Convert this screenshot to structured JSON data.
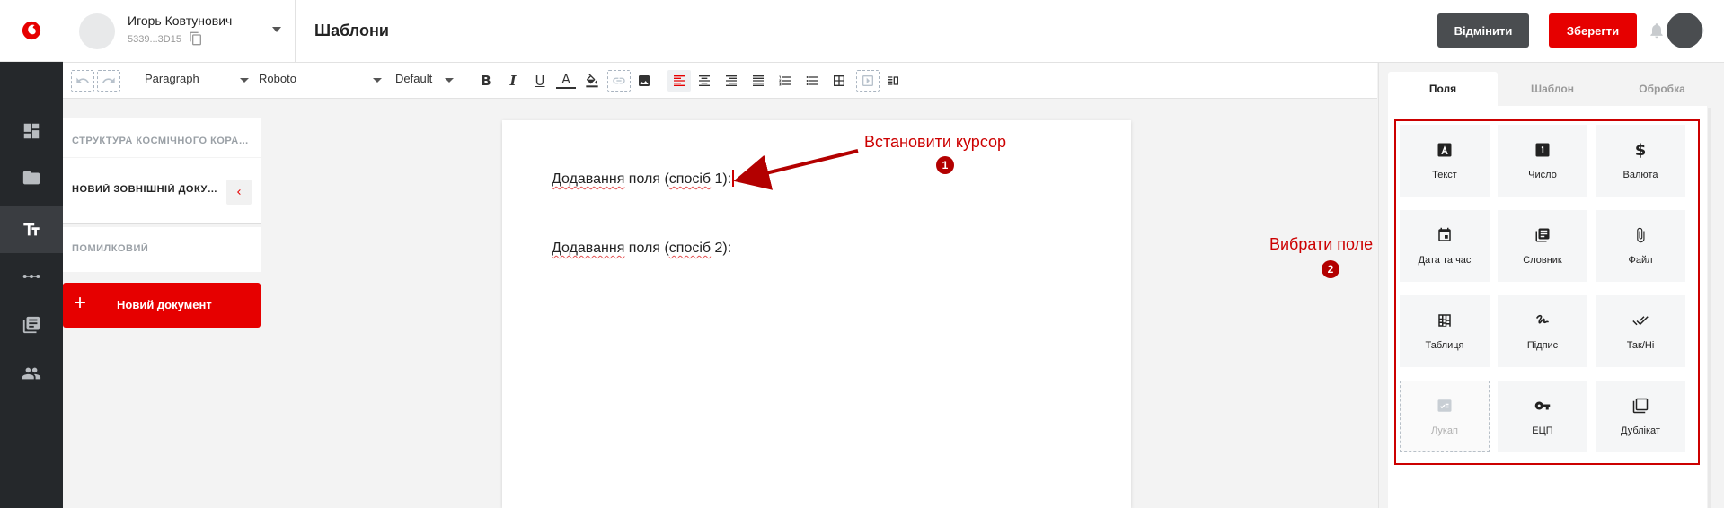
{
  "header": {
    "user_name": "Игорь Ковтунович",
    "user_id": "5339...3D15",
    "page_title": "Шаблони",
    "cancel_label": "Відмінити",
    "save_label": "Зберегти"
  },
  "toolbar": {
    "block_format": "Paragraph",
    "font_family": "Roboto",
    "font_size": "Default"
  },
  "doclist": {
    "items": [
      {
        "label": "СТРУКТУРА КОСМІЧНОГО КОРАБЛЯ"
      },
      {
        "label": "НОВИЙ ЗОВНІШНІЙ ДОКУМЕНТ"
      },
      {
        "label": "ПОМИЛКОВИЙ"
      }
    ],
    "new_document_label": "Новий документ"
  },
  "document": {
    "para1_a": "Додавання",
    "para1_b": " поля (",
    "para1_c": "спосіб",
    "para1_d": " 1):",
    "para2_a": "Додавання",
    "para2_b": " поля (",
    "para2_c": "спосіб",
    "para2_d": " 2):"
  },
  "annotations": {
    "step1_text": "Встановити курсор",
    "step1_num": "1",
    "step2_text": "Вибрати поле",
    "step2_num": "2"
  },
  "right_panel": {
    "tabs": [
      {
        "label": "Поля"
      },
      {
        "label": "Шаблон"
      },
      {
        "label": "Обробка"
      }
    ],
    "fields": [
      {
        "label": "Текст",
        "icon": "text-icon"
      },
      {
        "label": "Число",
        "icon": "number-icon"
      },
      {
        "label": "Валюта",
        "icon": "currency-icon"
      },
      {
        "label": "Дата та час",
        "icon": "calendar-icon"
      },
      {
        "label": "Словник",
        "icon": "dictionary-icon"
      },
      {
        "label": "Файл",
        "icon": "paperclip-icon"
      },
      {
        "label": "Таблиця",
        "icon": "table-icon"
      },
      {
        "label": "Підпис",
        "icon": "signature-icon"
      },
      {
        "label": "Так/Ні",
        "icon": "double-check-icon"
      },
      {
        "label": "Лукап",
        "icon": "lookup-icon"
      },
      {
        "label": "ЕЦП",
        "icon": "key-icon"
      },
      {
        "label": "Дублікат",
        "icon": "duplicate-icon"
      }
    ]
  },
  "colors": {
    "brand_red": "#e60000",
    "rail_bg": "#25282b",
    "annotation_red": "#cc0000"
  }
}
